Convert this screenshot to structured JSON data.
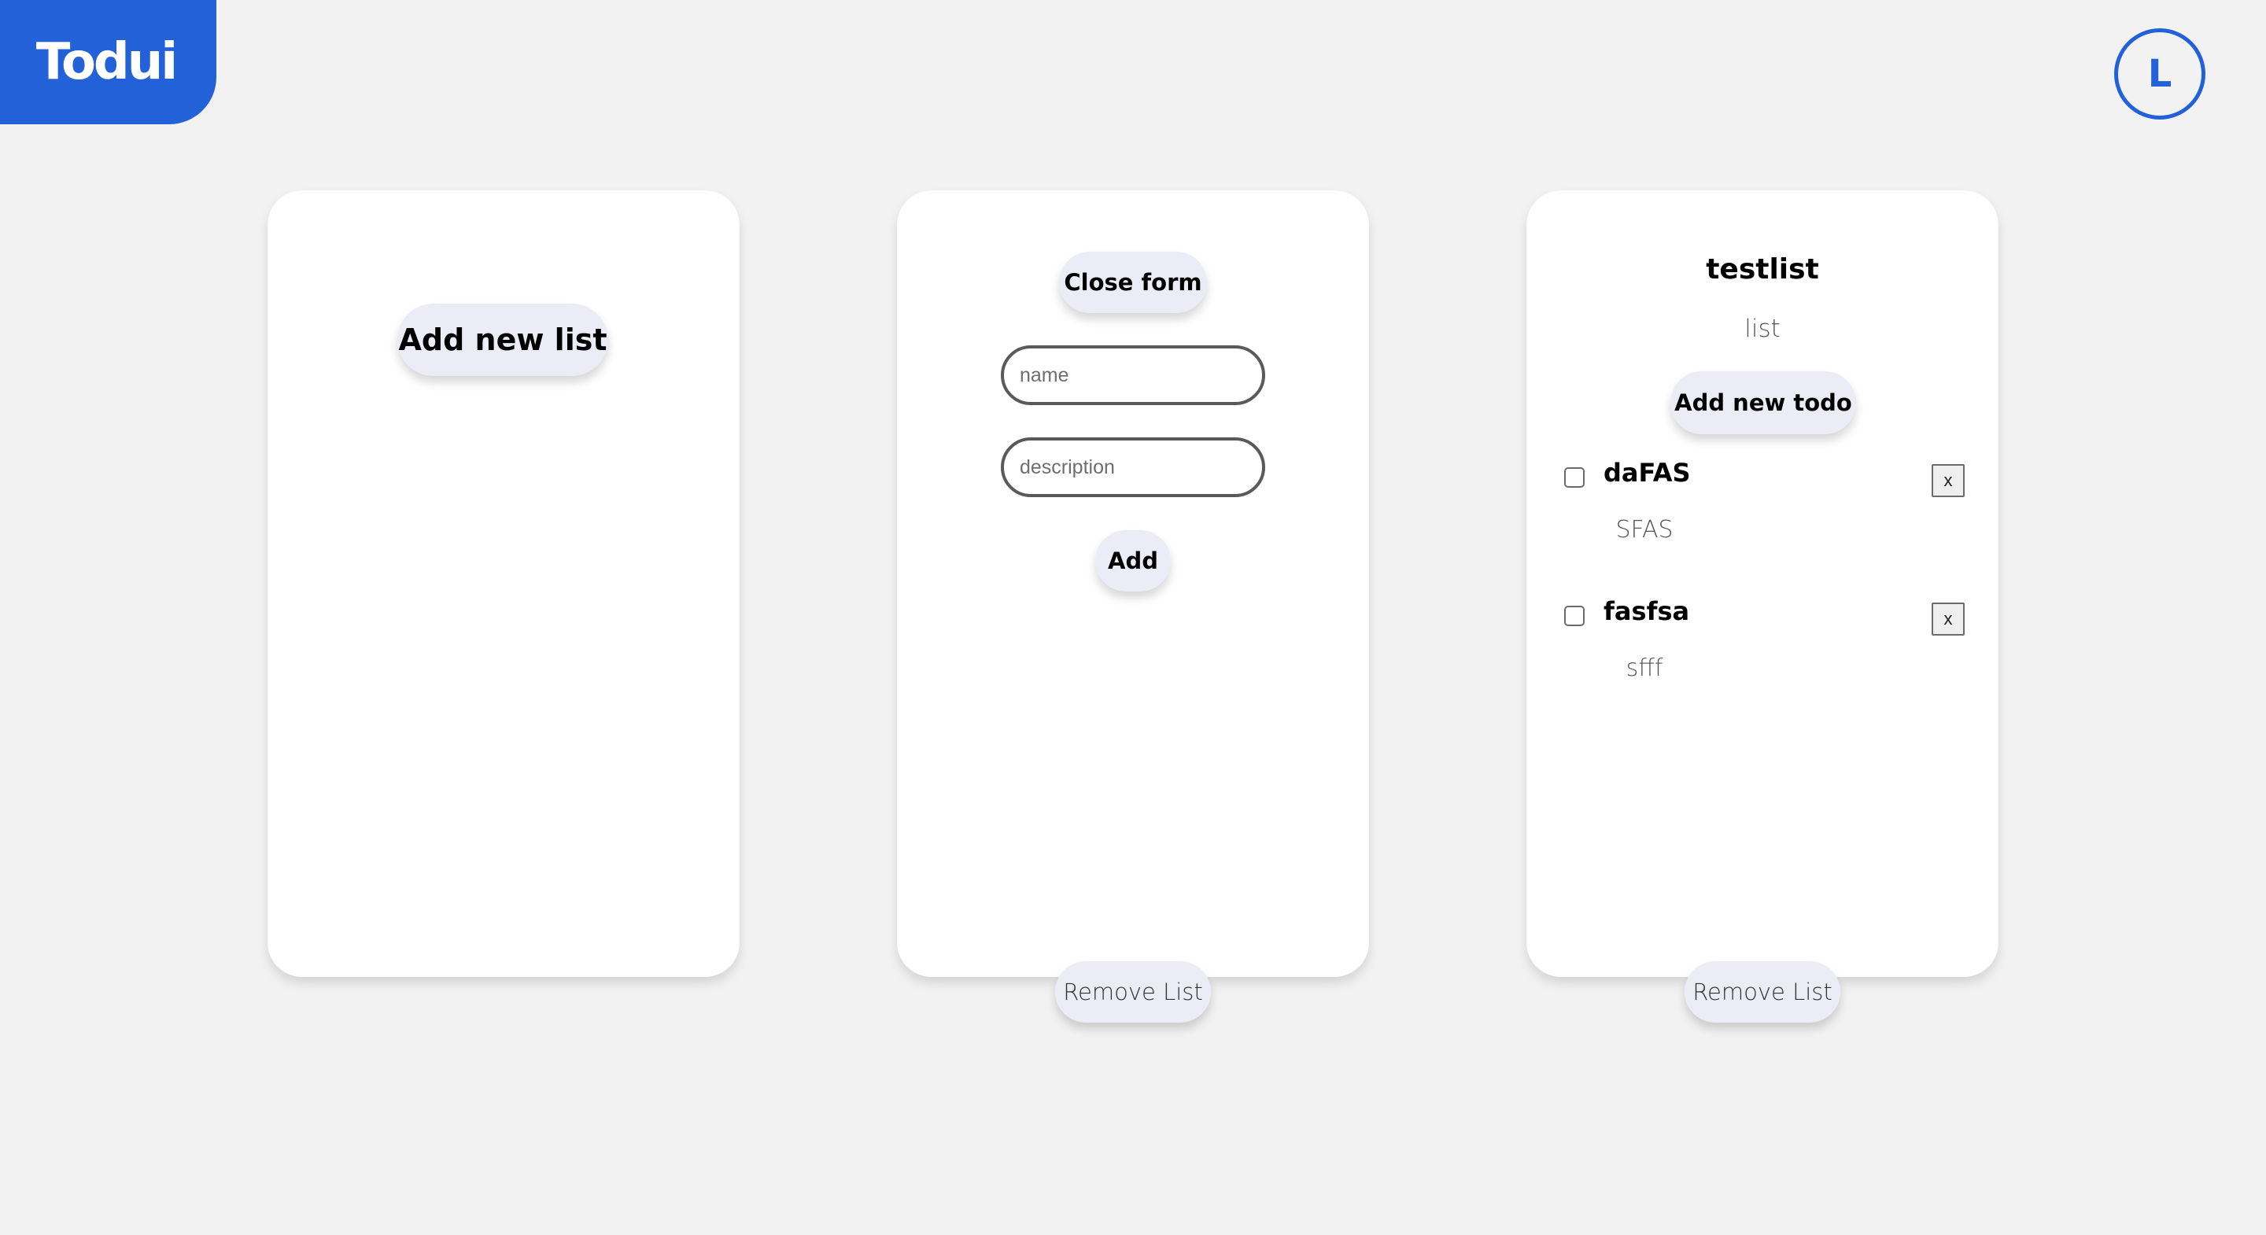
{
  "brand": {
    "logo_text": "Todui",
    "color": "#2361d8"
  },
  "user": {
    "avatar_initial": "L"
  },
  "cards": {
    "new_list": {
      "add_list_label": "Add new list"
    },
    "form": {
      "close_label": "Close form",
      "name_placeholder": "name",
      "description_placeholder": "description",
      "add_label": "Add",
      "remove_label": "Remove List"
    },
    "list": {
      "title": "testlist",
      "description": "list",
      "add_todo_label": "Add new todo",
      "remove_label": "Remove List",
      "todos": [
        {
          "name": "daFAS",
          "description": "SFAS",
          "checked": false,
          "delete_label": "x"
        },
        {
          "name": "fasfsa",
          "description": "sfff",
          "checked": false,
          "delete_label": "x"
        }
      ]
    }
  },
  "colors": {
    "background": "#f2f2f2",
    "card": "#ffffff",
    "pill": "#ececf6",
    "accent": "#2361d8"
  }
}
